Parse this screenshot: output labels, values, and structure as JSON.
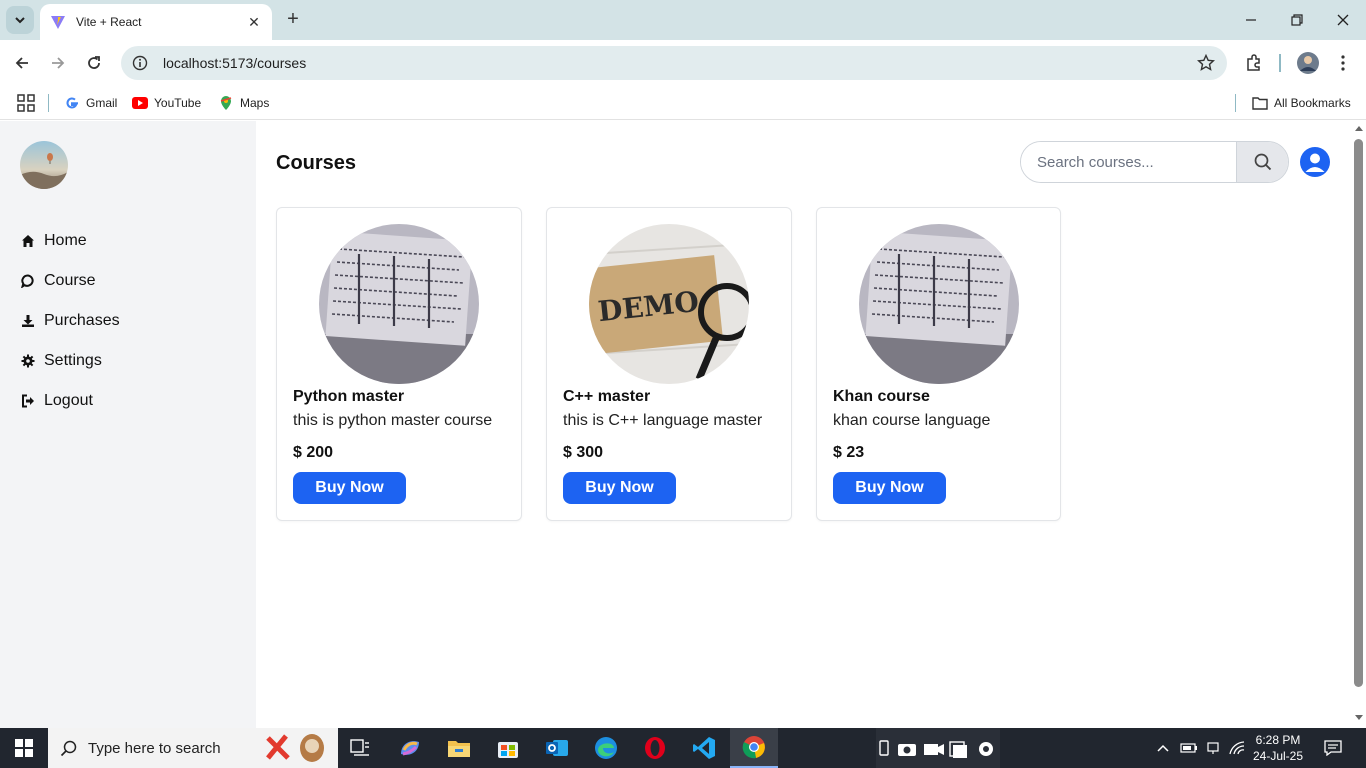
{
  "browser": {
    "tab_title": "Vite + React",
    "url": "localhost:5173/courses",
    "bookmarks": [
      {
        "label": "Gmail"
      },
      {
        "label": "YouTube"
      },
      {
        "label": "Maps"
      }
    ],
    "all_bookmarks": "All Bookmarks"
  },
  "sidebar": {
    "items": [
      {
        "label": "Home",
        "icon": "home-icon"
      },
      {
        "label": "Course",
        "icon": "chat-icon"
      },
      {
        "label": "Purchases",
        "icon": "download-icon"
      },
      {
        "label": "Settings",
        "icon": "gear-icon"
      },
      {
        "label": "Logout",
        "icon": "logout-icon"
      }
    ]
  },
  "main": {
    "title": "Courses",
    "search_placeholder": "Search courses..."
  },
  "courses": [
    {
      "title": "Python master",
      "description": "this is python master course",
      "price": "$ 200",
      "button": "Buy Now",
      "image": "paper-document-image"
    },
    {
      "title": "C++ master",
      "description": "this is C++ language master",
      "price": "$ 300",
      "button": "Buy Now",
      "image": "demo-card-image"
    },
    {
      "title": "Khan course",
      "description": "khan course language",
      "price": "$ 23",
      "button": "Buy Now",
      "image": "paper-document-image"
    }
  ],
  "taskbar": {
    "search_text": "Type here to search",
    "time": "6:28 PM",
    "date": "24-Jul-25"
  },
  "colors": {
    "accent": "#1d63f2",
    "sidebar_bg": "#f3f4f6",
    "tabstrip_bg": "#d3e3e6",
    "taskbar_bg": "#21262f"
  }
}
